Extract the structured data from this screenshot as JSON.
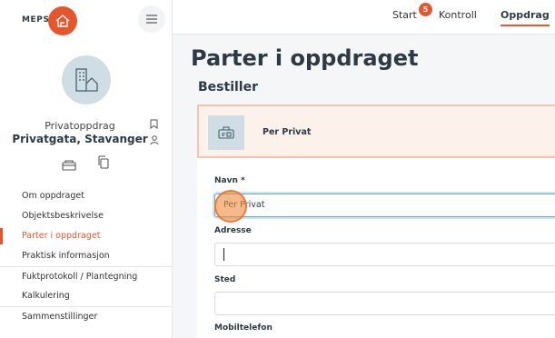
{
  "brand": {
    "name": "MEPS"
  },
  "sidebar": {
    "property_type": "Privatoppdrag",
    "property_address": "Privatgata, Stavanger",
    "nav": [
      {
        "label": "Om oppdraget"
      },
      {
        "label": "Objektsbeskrivelse"
      },
      {
        "label": "Parter i oppdraget"
      },
      {
        "label": "Praktisk informasjon"
      },
      {
        "label": "Fuktprotokoll / Plantegning"
      },
      {
        "label": "Kalkulering"
      },
      {
        "label": "Sammenstillinger"
      }
    ],
    "active_item": "Parter i oppdraget"
  },
  "topbar": {
    "tabs": [
      {
        "label": "Start",
        "badge": "5"
      },
      {
        "label": "Kontroll"
      },
      {
        "label": "Oppdrag",
        "active": true
      }
    ]
  },
  "main": {
    "title": "Parter i oppdraget",
    "section": "Bestiller",
    "party": {
      "name": "Per Privat"
    },
    "form": {
      "name_label": "Navn *",
      "name_value": "Per Privat",
      "address_label": "Adresse",
      "address_value": "",
      "place_label": "Sted",
      "place_value": "",
      "mobile_label": "Mobiltelefon"
    }
  },
  "colors": {
    "accent": "#e4572e",
    "muted_blue": "#cfdde4",
    "text_dark": "#2d3a46"
  },
  "icons": [
    "house-logo-icon",
    "hamburger-icon",
    "building-house-icon",
    "bookmark-icon",
    "person-icon",
    "inspection-icon",
    "copy-icon",
    "id-card-icon"
  ]
}
